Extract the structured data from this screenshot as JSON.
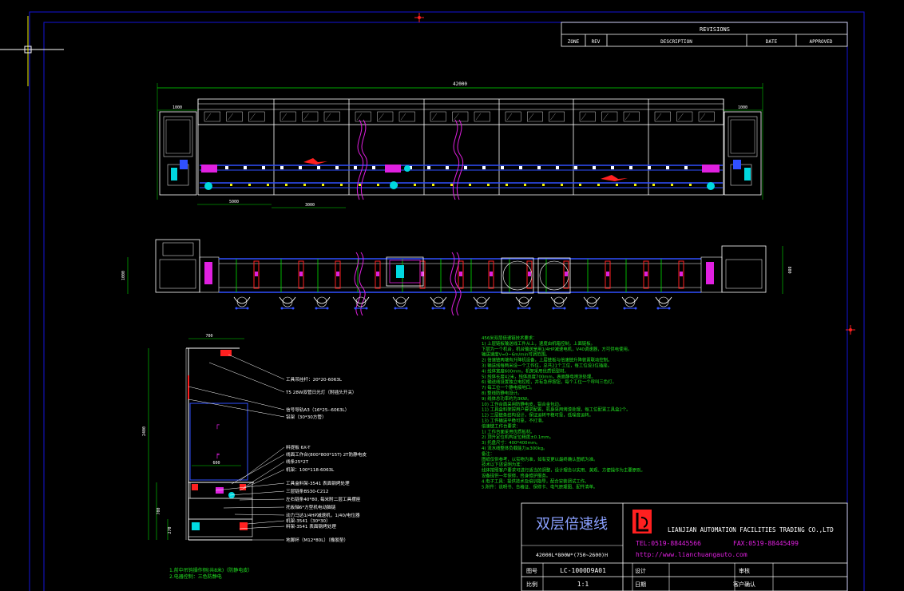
{
  "revisions": {
    "title": "REVISIONS",
    "columns": [
      "ZONE",
      "REV",
      "DESCRIPTION",
      "DATE",
      "APPROVED"
    ]
  },
  "dimensions": {
    "overall_length": "42000",
    "left_end": "1000",
    "right_end": "1000",
    "span_a": "5000",
    "span_b": "3000",
    "plan_width": "1000",
    "plan_width_right": "800",
    "section_width": "700",
    "section_height": "2400",
    "section_lower_width": "600",
    "section_lower_height": "700",
    "section_base_height": "270"
  },
  "section_callouts": [
    "工具吊挂杆：20*20-6063L",
    "T5 28W双管日光灯（附插头开关）",
    "信号导轨A3（16*25--6063L）",
    "铝架（30*30方管）",
    "料提板 6X-T",
    "线面工作台(800*800*15T) 2T防静电皮",
    "线条25*2T",
    "机架：100*118-6063L",
    "工具盒料架-3541 表面钢烤处理",
    "三层链条BS30-C212",
    "左右链条40*80, 每米附二层工具摆座",
    "托板轴6*方型机电动脑链",
    "动力马达1/4HP减速机，1/40/电位器",
    "机架-3541（30*30）",
    "料架-3541 表面钢烤处理",
    "地脚杯（M12*80L）（橡胶垫）"
  ],
  "section_footnotes": [
    "1.前中吊钩操作侧(共8米)（防静电皮）",
    "2.电器控制：三色防静电"
  ],
  "spec_notes": [
    "456米双层倍速链技术要求：",
    "1) 上层链板输送线工件从上，速度由机箱控制，上面链板。",
    "   下层为一个机台，机台输送是用1/4HP减速电机，V40调速器，方可供电使用。",
    "   输送速度V=0~6m/min可调范围。",
    "2) 倍速链两端有升降机设备，上层链板与倍速链升降装置联动控制。",
    "3) 输送线每两米设一个工作位，总共21个工位，每工位设3位插座。",
    "4) 线体宽度600mm，机架采用优质铝型材。",
    "5) 线体长度42米，线体高度700mm，表面静电喷涂处理。",
    "6) 输送线设置独立电控柜，并有急停按钮，每个工位一个呼叫三色灯。",
    "7) 每工位一个静电接地口。",
    "8) 整线防静电设计。",
    "9) 线体总功率约为3KW。",
    "10) 工作台面采用防静电皮，铝合金包边。",
    "11) 工具盒料架按用户要求配置，机身采用烤漆处理，每工位配置工具盒2个。",
    "12) 三层链条结构设计，保证运转平稳可靠，低噪音运转。",
    "13) 工件输送平稳可靠，不打滑。",
    "倍速链工作台要求：",
    "1) 工作台面采用优质板材。",
    "2) 顶升定位机构定位精度±0.1mm。",
    "3) 托盘尺寸：400*400mm。",
    "4) 流水线整体负载能力≥300kg。",
    "备注：",
    "图纸仅供参考，以实物为准，如有变更以最终确认图纸为准。",
    "技术以下述说明为准：",
    "线体按照客户要求可进行适当的调整，设计理念以实用、美观、方便操作为主要原则。",
    "设备提供一年保修，终身维护服务。",
    "4.电子工具：提供技术及培训指导，配合安装调试工作。",
    "5.附件：说明书、合格证、保修卡、电气原理图、配件清单。"
  ],
  "title_block": {
    "product_name": "双层倍速线",
    "size_spec": "42000L*800W*(750~2600)H",
    "company_name": "LIANJIAN AUTOMATION FACILITIES TRADING CO.,LTD",
    "tel": "TEL:0519-88445566",
    "fax": "FAX:0519-88445499",
    "website": "http://www.lianchuangauto.com",
    "drawing_no_label": "图号",
    "drawing_no": "LC-1000D9A01",
    "designer_label": "设计",
    "checker_label": "审核",
    "scale_label": "比例",
    "scale": "1:1",
    "date_label": "日期",
    "customer_label": "客户确认"
  },
  "colors": {
    "background": "#000000",
    "border": "#1414d8",
    "linework": "#ffffff",
    "dimension": "#00e000",
    "conveyor": "#3050ff",
    "accent_red": "#ff2020",
    "accent_magenta": "#e020e0",
    "accent_cyan": "#00d8e0",
    "text_green": "#20e020",
    "text_yellow": "#f0f000",
    "title_blue": "#8aa0ff"
  }
}
